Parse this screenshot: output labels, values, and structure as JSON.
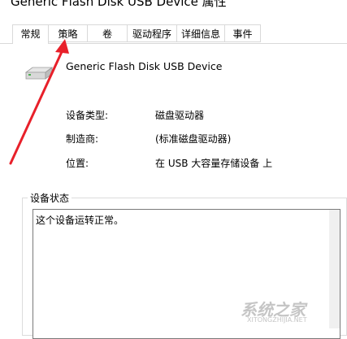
{
  "window": {
    "title": "Generic Flash Disk USB Device 属性"
  },
  "tabs": [
    {
      "label": "常规",
      "active": true
    },
    {
      "label": "策略",
      "active": false
    },
    {
      "label": "卷",
      "active": false
    },
    {
      "label": "驱动程序",
      "active": false
    },
    {
      "label": "详细信息",
      "active": false
    },
    {
      "label": "事件",
      "active": false
    }
  ],
  "device": {
    "name": "Generic Flash Disk USB Device",
    "icon": "usb-drive-icon"
  },
  "properties": [
    {
      "label": "设备类型:",
      "value": "磁盘驱动器"
    },
    {
      "label": "制造商:",
      "value": "(标准磁盘驱动器)"
    },
    {
      "label": "位置:",
      "value": "在 USB 大容量存储设备 上"
    }
  ],
  "status": {
    "group_title": "设备状态",
    "text": "这个设备运转正常。"
  },
  "annotation": {
    "color": "#e8202a"
  },
  "watermark": {
    "text": "系统之家",
    "sub": "XITONGZHIJIA.NET"
  }
}
